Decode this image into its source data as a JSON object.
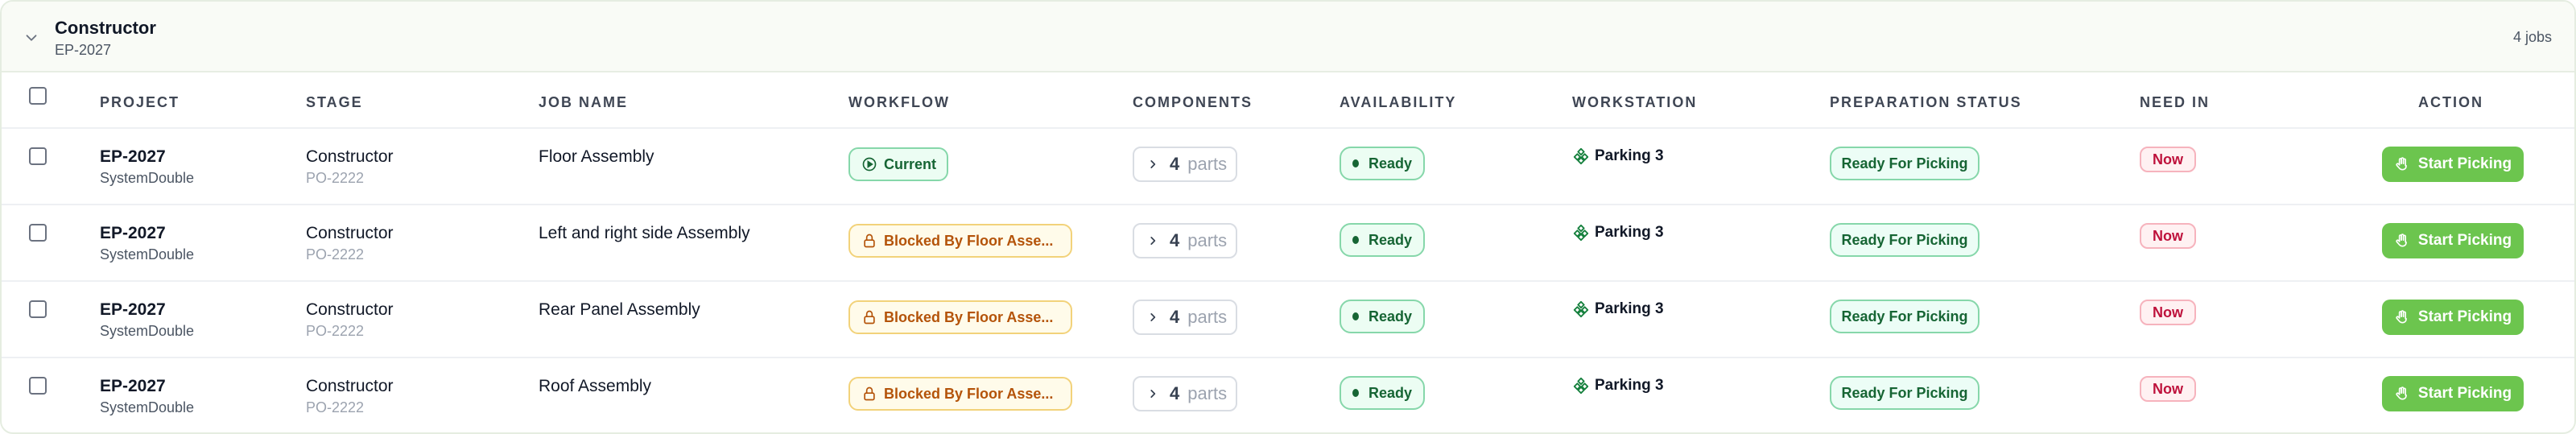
{
  "group": {
    "title": "Constructor",
    "subtitle": "EP-2027",
    "jobs_count": "4 jobs"
  },
  "columns": {
    "project": "PROJECT",
    "stage": "STAGE",
    "job_name": "JOB NAME",
    "workflow": "WORKFLOW",
    "components": "COMPONENTS",
    "availability": "AVAILABILITY",
    "workstation": "WORKSTATION",
    "preparation_status": "PREPARATION STATUS",
    "need_in": "NEED IN",
    "action": "ACTION"
  },
  "rows": [
    {
      "project": "EP-2027",
      "project_sub": "SystemDouble",
      "stage": "Constructor",
      "stage_sub": "PO-2222",
      "job_name": "Floor Assembly",
      "workflow": "Current",
      "workflow_state": "current",
      "components_count": "4",
      "components_unit": "parts",
      "availability": "Ready",
      "workstation": "Parking 3",
      "preparation_status": "Ready For Picking",
      "need_in": "Now",
      "action": "Start Picking"
    },
    {
      "project": "EP-2027",
      "project_sub": "SystemDouble",
      "stage": "Constructor",
      "stage_sub": "PO-2222",
      "job_name": "Left and right side Assembly",
      "workflow": "Blocked By Floor Asse...",
      "workflow_state": "blocked",
      "components_count": "4",
      "components_unit": "parts",
      "availability": "Ready",
      "workstation": "Parking 3",
      "preparation_status": "Ready For Picking",
      "need_in": "Now",
      "action": "Start Picking"
    },
    {
      "project": "EP-2027",
      "project_sub": "SystemDouble",
      "stage": "Constructor",
      "stage_sub": "PO-2222",
      "job_name": "Rear Panel Assembly",
      "workflow": "Blocked By Floor Asse...",
      "workflow_state": "blocked",
      "components_count": "4",
      "components_unit": "parts",
      "availability": "Ready",
      "workstation": "Parking 3",
      "preparation_status": "Ready For Picking",
      "need_in": "Now",
      "action": "Start Picking"
    },
    {
      "project": "EP-2027",
      "project_sub": "SystemDouble",
      "stage": "Constructor",
      "stage_sub": "PO-2222",
      "job_name": "Roof Assembly",
      "workflow": "Blocked By Floor Asse...",
      "workflow_state": "blocked",
      "components_count": "4",
      "components_unit": "parts",
      "availability": "Ready",
      "workstation": "Parking 3",
      "preparation_status": "Ready For Picking",
      "need_in": "Now",
      "action": "Start Picking"
    }
  ],
  "icons": {
    "group_toggle": "chevron-down-icon",
    "workflow_current": "play-circle-icon",
    "workflow_blocked": "lock-icon",
    "components_expand": "chevron-right-icon",
    "workstation": "workstation-cluster-icon",
    "action": "hand-icon"
  },
  "colors": {
    "accent_green": "#6cc54e",
    "ready_green": "#166534",
    "blocked_amber": "#b45309",
    "now_red": "#be123c"
  }
}
